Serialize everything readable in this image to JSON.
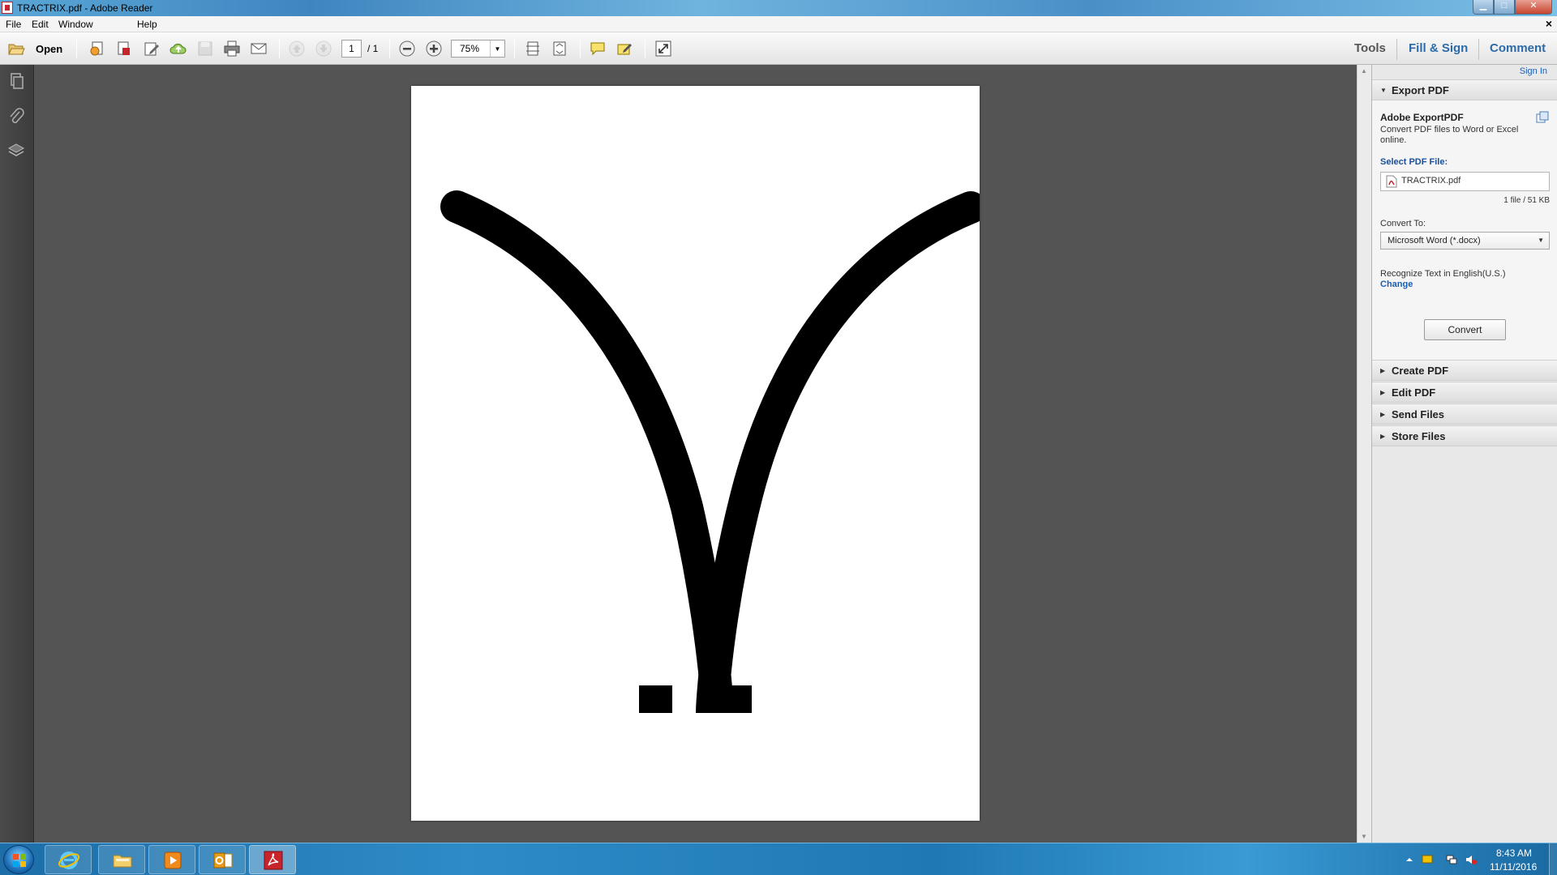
{
  "window": {
    "title": "TRACTRIX.pdf - Adobe Reader",
    "min_glyph": "▁",
    "max_glyph": "□",
    "close_glyph": "✕"
  },
  "menubar": {
    "items": [
      "File",
      "Edit",
      "Window",
      "Help"
    ],
    "close_doc": "×"
  },
  "toolbar": {
    "open_label": "Open",
    "page_current": "1",
    "page_total": "/ 1",
    "zoom": "75%",
    "zoom_dropdown_glyph": "▼",
    "tabs": {
      "tools": "Tools",
      "fill_sign": "Fill & Sign",
      "comment": "Comment"
    }
  },
  "right_pane": {
    "sign_in": "Sign In",
    "export_pdf": {
      "header": "Export PDF",
      "expanded_glyph": "▼",
      "title": "Adobe ExportPDF",
      "description": "Convert PDF files to Word or Excel online.",
      "select_label": "Select PDF File:",
      "file_name": "TRACTRIX.pdf",
      "file_size": "1 file / 51 KB",
      "convert_to_label": "Convert To:",
      "format": "Microsoft Word (*.docx)",
      "format_dropdown_glyph": "▼",
      "ocr_label": "Recognize Text in English(U.S.)",
      "ocr_change": "Change",
      "convert_button": "Convert"
    },
    "sections": [
      {
        "label": "Create PDF",
        "glyph": "▶"
      },
      {
        "label": "Edit PDF",
        "glyph": "▶"
      },
      {
        "label": "Send Files",
        "glyph": "▶"
      },
      {
        "label": "Store Files",
        "glyph": "▶"
      }
    ]
  },
  "scrollbar": {
    "up_glyph": "▲",
    "down_glyph": "▼"
  },
  "taskbar": {
    "time": "8:43 AM",
    "date": "11/11/2016",
    "tray_expand_glyph": "▲"
  },
  "colors": {
    "accent_link": "#1a5fb4",
    "tab_link": "#2c6aa8",
    "document_bg": "#545454",
    "pdf_red": "#c8242b"
  }
}
